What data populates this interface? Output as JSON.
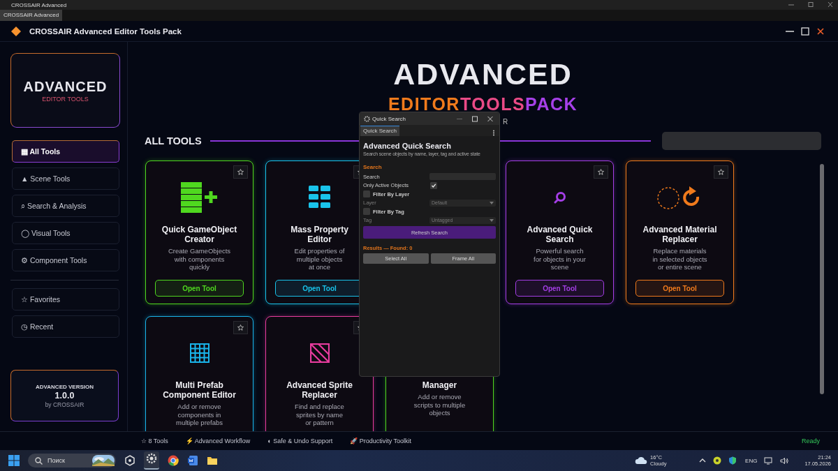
{
  "os_window": {
    "title": "CROSSAIR Advanced",
    "tab": "CROSSAIR Advanced"
  },
  "header": {
    "title": "CROSSAIR Advanced Editor Tools Pack"
  },
  "sidebar": {
    "logo": {
      "title": "ADVANCED",
      "subtitle": "EDITOR TOOLS"
    },
    "nav": [
      {
        "label": "▦ All Tools",
        "selected": true
      },
      {
        "label": "▲ Scene Tools",
        "selected": false
      },
      {
        "label": "⌕ Search & Analysis",
        "selected": false
      },
      {
        "label": "◯ Visual Tools",
        "selected": false
      },
      {
        "label": "⚙ Component Tools",
        "selected": false
      }
    ],
    "secondary": [
      {
        "label": "☆ Favorites",
        "selected": false
      },
      {
        "label": "◷ Recent",
        "selected": false
      }
    ],
    "version": {
      "label": "ADVANCED VERSION",
      "number": "1.0.0",
      "by": "by CROSSAIR"
    }
  },
  "hero": {
    "title": "ADVANCED",
    "subtitle": [
      {
        "text": "EDITOR",
        "color": "#f07a1c"
      },
      {
        "text": "TOOLS",
        "color": "#ea4a86"
      },
      {
        "text": "PACK",
        "color": "#a640e8"
      }
    ],
    "byline": "R"
  },
  "section": {
    "title": "ALL TOOLS"
  },
  "tool_rows": [
    [
      {
        "kind": "stack",
        "color": "#4fd81f",
        "title": [
          "Quick GameObject",
          "Creator"
        ],
        "description": [
          "Create GameObjects",
          "with components",
          "quickly"
        ],
        "button": "Open Tool"
      },
      {
        "kind": "tiles",
        "color": "#19c3ea",
        "title": [
          "Mass Property",
          "Editor"
        ],
        "description": [
          "Edit properties of",
          "multiple objects",
          "at once"
        ],
        "button": "Open Tool"
      },
      {
        "kind": "magnifier",
        "color": "#a43ee6",
        "title": [
          "Advanced Quick",
          "Search"
        ],
        "description": [
          "Powerful search",
          "for objects in your",
          "scene"
        ],
        "button": "Open Tool"
      },
      {
        "kind": "swap",
        "color": "#f07a1c",
        "title": [
          "Advanced Material",
          "Replacer"
        ],
        "description": [
          "Replace materials",
          "in selected objects",
          "or entire scene"
        ],
        "button": "Open Tool"
      }
    ],
    [
      {
        "kind": "grid",
        "color": "#19b4ea",
        "title": [
          "Multi Prefab",
          "Component Editor"
        ],
        "description": [
          "Add or remove",
          "components in",
          "multiple prefabs"
        ]
      },
      {
        "kind": "hatch",
        "color": "#e83c9e",
        "title": [
          "Advanced Sprite",
          "Replacer"
        ],
        "description": [
          "Find and replace",
          "sprites by name",
          "or pattern"
        ]
      },
      {
        "color": "#4fd81f",
        "title": [
          "Manager"
        ],
        "description": [
          "Add or remove",
          "scripts to multiple",
          "objects"
        ]
      }
    ]
  ],
  "status_bar": {
    "items": [
      {
        "label": "☆ 8 Tools"
      },
      {
        "label": "⚡ Advanced Workflow"
      },
      {
        "label": "◐ Safe & Undo Support"
      },
      {
        "label": "🚀 Productivity Toolkit"
      }
    ],
    "status": "Ready"
  },
  "quick_search": {
    "title": "Quick Search",
    "tab": "Quick Search",
    "heading": "Advanced Quick Search",
    "subheading": "Search scene objects by name, layer, tag and active state",
    "section": "Search",
    "fields": [
      {
        "kind": "text",
        "label": "Search"
      },
      {
        "kind": "check",
        "label": "Only Active Objects",
        "checked": true
      },
      {
        "kind": "toggle",
        "label": "Filter By Layer",
        "checked": false
      },
      {
        "kind": "dropdown",
        "label": "Layer",
        "value": "Default",
        "disabled": true
      },
      {
        "kind": "toggle",
        "label": "Filter By Tag",
        "checked": false
      },
      {
        "kind": "dropdown",
        "label": "Tag",
        "value": "Untagged",
        "disabled": true
      }
    ],
    "button": "Refresh Search",
    "results": "Results — Found: 0",
    "actions": [
      "Select All",
      "Frame All"
    ]
  },
  "taskbar": {
    "search": "Поиск",
    "weather": {
      "temp": "16°C",
      "text": "Cloudy"
    },
    "language": "ENG",
    "time": "21:24",
    "date": "17.05.2026"
  }
}
